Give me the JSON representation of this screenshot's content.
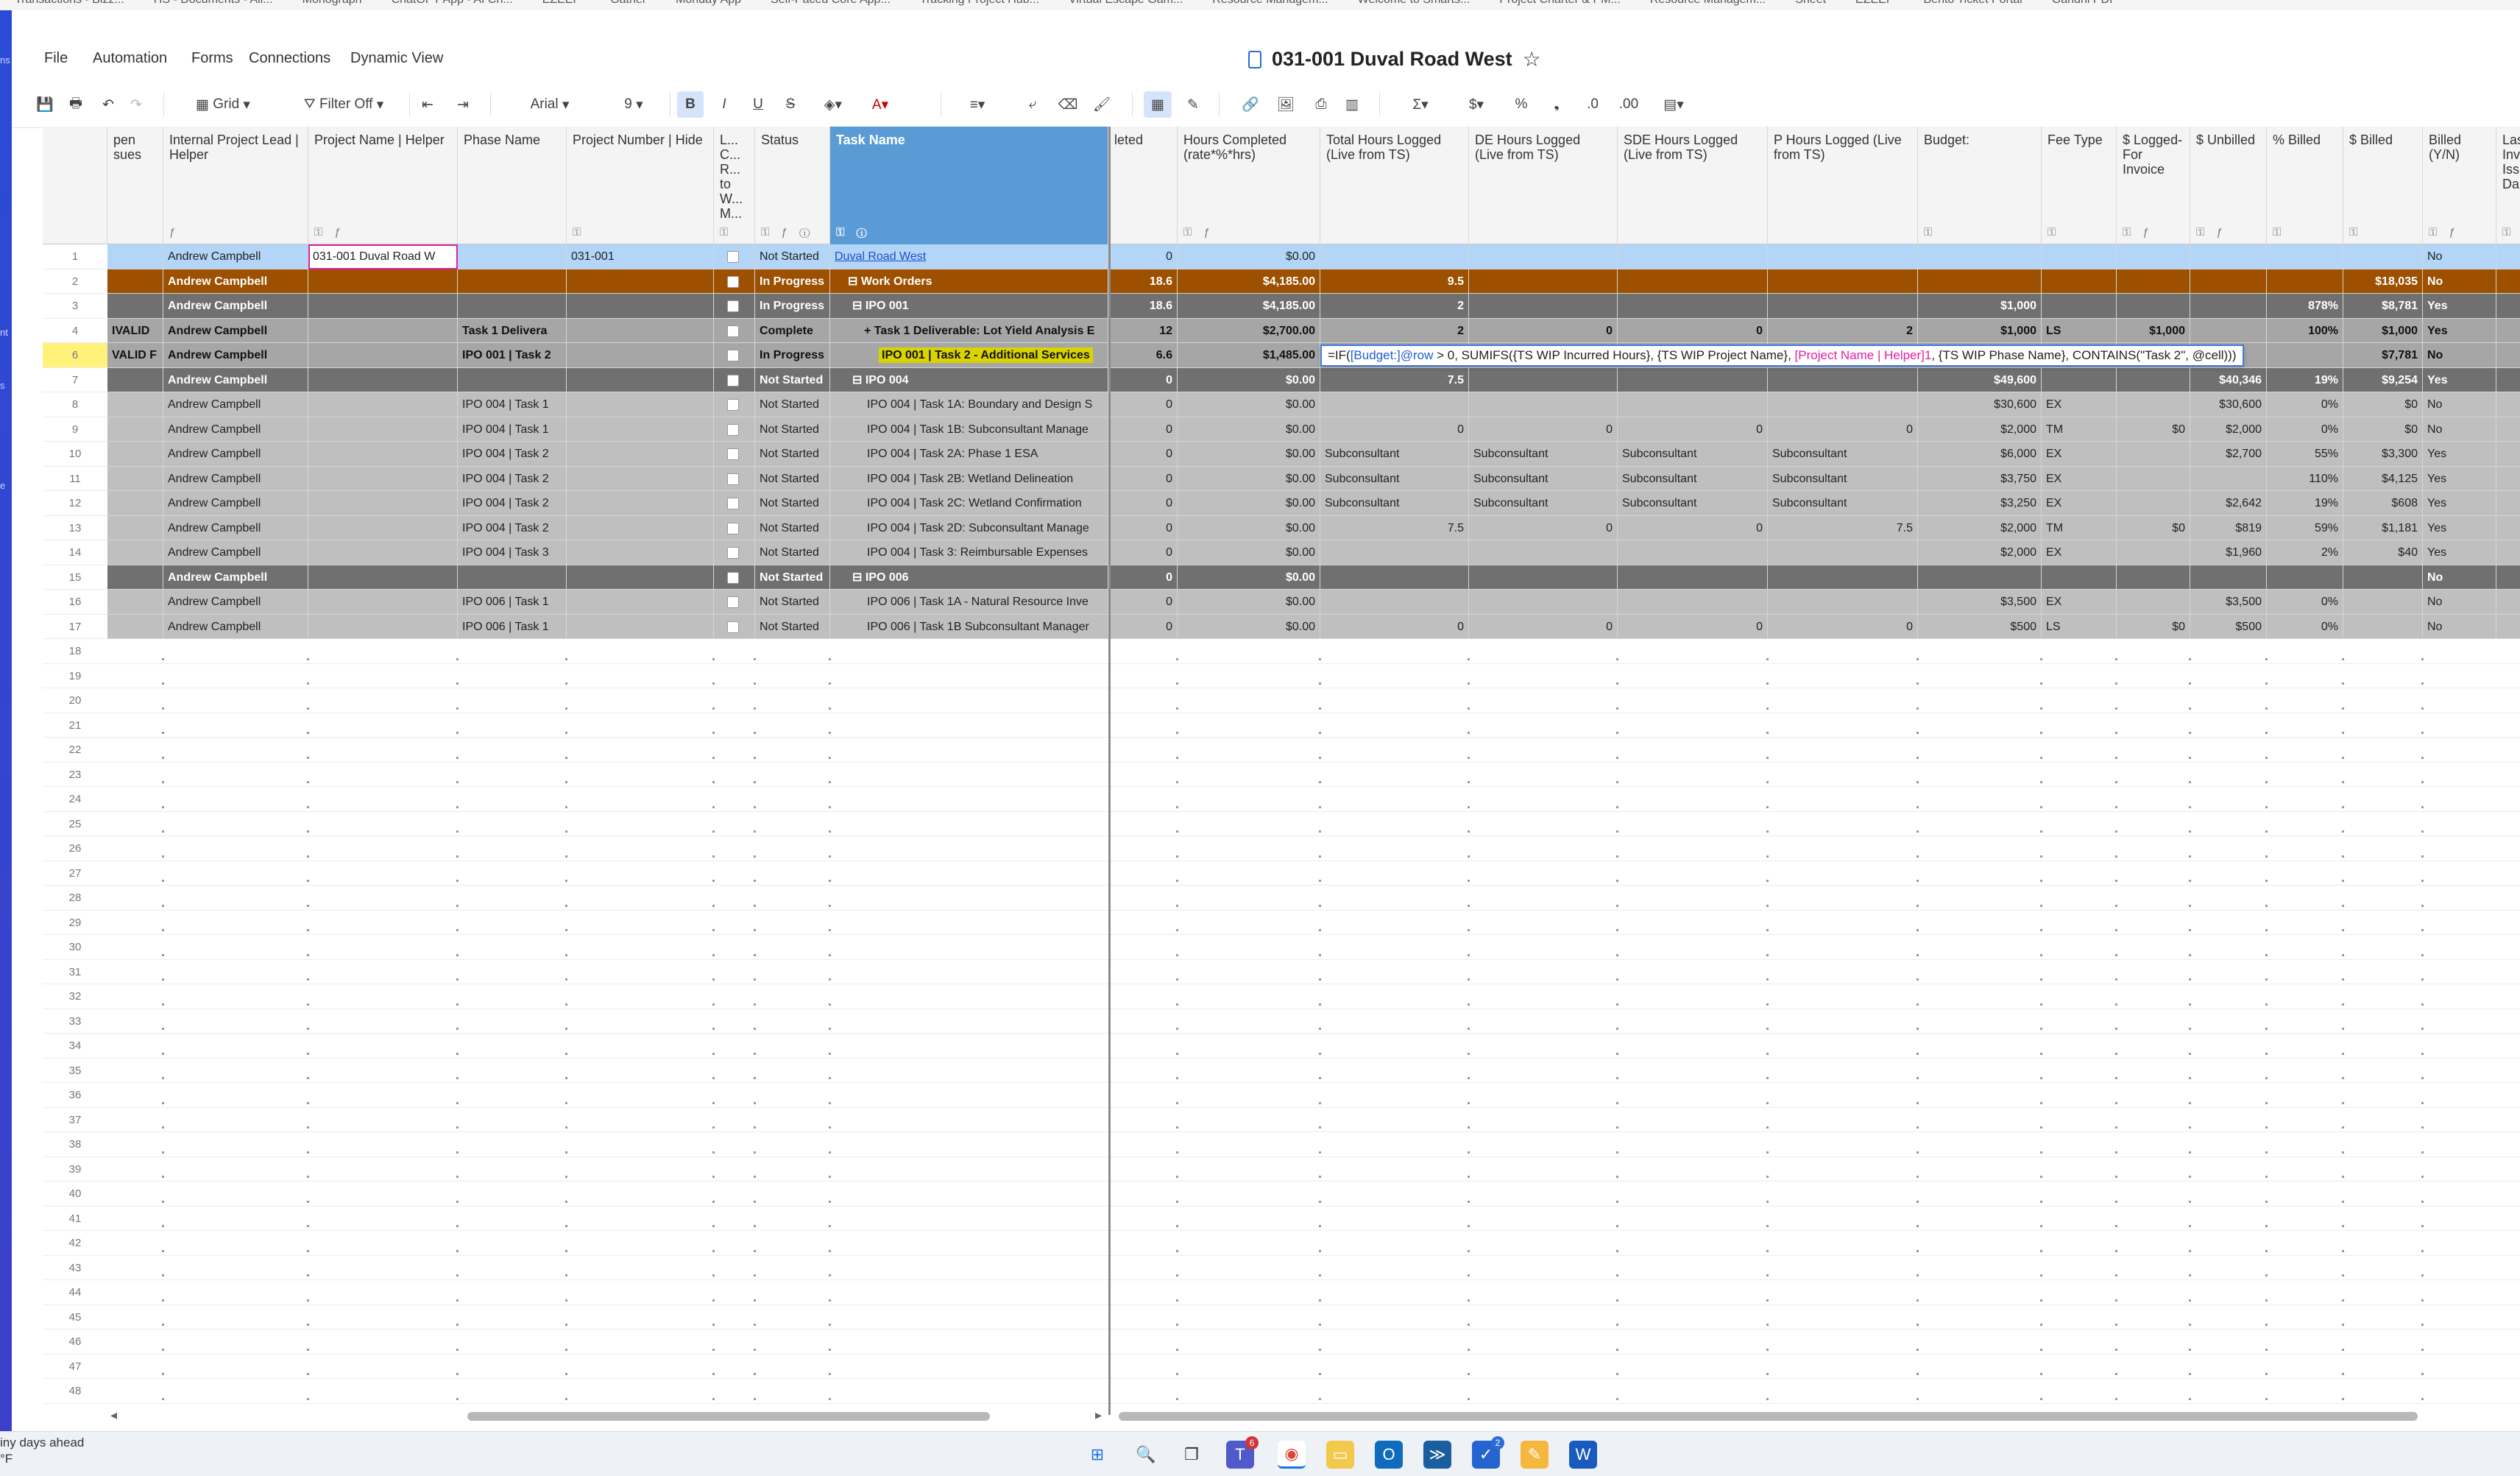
{
  "bookmarks": [
    "Transactions - Bizz...",
    "HS - Documents - All...",
    "Monograph",
    "ChatGPT App - AI Ch...",
    "EZEEP",
    "Gather",
    "Monday App",
    "Self-Paced Core App...",
    "Tracking Project Hub...",
    "Virtual Escape Gam...",
    "Resource Managem...",
    "Welcome to Smarts...",
    "Project Charter & PM...",
    "Resource Managem...",
    "Sheet",
    "EZEEP",
    "Bento Ticket Portal",
    "Gandhi PDF"
  ],
  "left_rail": [
    "ns",
    "nt",
    "s",
    "e"
  ],
  "menu": {
    "file": "File",
    "automation": "Automation",
    "forms": "Forms",
    "connections": "Connections",
    "dynamic_view": "Dynamic View"
  },
  "doc": {
    "title": "031-001 Duval Road West"
  },
  "toolbar": {
    "view": "Grid",
    "filter": "Filter Off",
    "font": "Arial",
    "size": "9"
  },
  "columns": [
    {
      "label": "pen\nsues"
    },
    {
      "label": "Internal Project Lead | Helper"
    },
    {
      "label": "Project Name | Helper"
    },
    {
      "label": "Phase Name"
    },
    {
      "label": "Project Number | Hide"
    },
    {
      "label": "L... C... R... to W... M..."
    },
    {
      "label": "Status"
    },
    {
      "label": "Task Name"
    },
    {
      "label": "leted"
    },
    {
      "label": "Hours Completed (rate*%*hrs)"
    },
    {
      "label": "Total Hours Logged (Live from TS)"
    },
    {
      "label": "DE Hours Logged (Live from TS)"
    },
    {
      "label": "SDE Hours Logged (Live from TS)"
    },
    {
      "label": "P Hours Logged (Live from TS)"
    },
    {
      "label": "Budget:"
    },
    {
      "label": "Fee Type"
    },
    {
      "label": "$ Logged- For Invoice"
    },
    {
      "label": "$ Unbilled"
    },
    {
      "label": "% Billed"
    },
    {
      "label": "$ Billed"
    },
    {
      "label": "Billed (Y/N)"
    },
    {
      "label": "Las Inv Iss Da"
    }
  ],
  "rows": [
    {
      "n": "1",
      "c": [
        "",
        "Andrew Campbell",
        "031-001 Duval Road W",
        "",
        "031-001",
        "",
        "Not Started",
        "Duval Road West",
        "0",
        "$0.00",
        "",
        "",
        "",
        "",
        "",
        "",
        "",
        "",
        "",
        "",
        "No",
        ""
      ]
    },
    {
      "n": "2",
      "c": [
        "",
        "Andrew Campbell",
        "",
        "",
        "",
        "",
        "In Progress",
        "Work Orders",
        "18.6",
        "$4,185.00",
        "9.5",
        "",
        "",
        "",
        "",
        "",
        "",
        "",
        "",
        "$18,035",
        "No",
        ""
      ]
    },
    {
      "n": "3",
      "c": [
        "",
        "Andrew Campbell",
        "",
        "",
        "",
        "",
        "In Progress",
        "IPO 001",
        "18.6",
        "$4,185.00",
        "2",
        "",
        "",
        "",
        "$1,000",
        "",
        "",
        "",
        "878%",
        "$8,781",
        "Yes",
        ""
      ]
    },
    {
      "n": "4",
      "c": [
        "IVALID",
        "Andrew Campbell",
        "",
        "Task 1 Delivera",
        "",
        "",
        "Complete",
        "Task 1 Deliverable: Lot Yield Analysis E",
        "12",
        "$2,700.00",
        "2",
        "0",
        "0",
        "2",
        "$1,000",
        "LS",
        "$1,000",
        "",
        "100%",
        "$1,000",
        "Yes",
        ""
      ]
    },
    {
      "n": "6",
      "c": [
        "VALID F",
        "Andrew Campbell",
        "",
        "IPO 001 | Task 2",
        "",
        "",
        "In Progress",
        "IPO 001 | Task 2 - Additional Services",
        "6.6",
        "$1,485.00",
        "",
        "",
        "",
        "",
        "",
        "",
        "",
        "",
        "",
        "$7,781",
        "No",
        ""
      ]
    },
    {
      "n": "7",
      "c": [
        "",
        "Andrew Campbell",
        "",
        "",
        "",
        "",
        "Not Started",
        "IPO 004",
        "0",
        "$0.00",
        "7.5",
        "",
        "",
        "",
        "$49,600",
        "",
        "",
        "$40,346",
        "19%",
        "$9,254",
        "Yes",
        ""
      ]
    },
    {
      "n": "8",
      "c": [
        "",
        "Andrew Campbell",
        "",
        "IPO 004 | Task 1",
        "",
        "",
        "Not Started",
        "IPO 004 | Task 1A: Boundary and Design S",
        "0",
        "$0.00",
        "",
        "",
        "",
        "",
        "$30,600",
        "EX",
        "",
        "$30,600",
        "0%",
        "$0",
        "No",
        ""
      ]
    },
    {
      "n": "9",
      "c": [
        "",
        "Andrew Campbell",
        "",
        "IPO 004 | Task 1",
        "",
        "",
        "Not Started",
        "IPO 004 | Task 1B: Subconsultant Manage",
        "0",
        "$0.00",
        "0",
        "0",
        "0",
        "0",
        "$2,000",
        "TM",
        "$0",
        "$2,000",
        "0%",
        "$0",
        "No",
        ""
      ]
    },
    {
      "n": "10",
      "c": [
        "",
        "Andrew Campbell",
        "",
        "IPO 004 | Task 2",
        "",
        "",
        "Not Started",
        "IPO 004 | Task 2A: Phase 1 ESA",
        "0",
        "$0.00",
        "Subconsultant",
        "Subconsultant",
        "Subconsultant",
        "Subconsultant",
        "$6,000",
        "EX",
        "",
        "$2,700",
        "55%",
        "$3,300",
        "Yes",
        ""
      ]
    },
    {
      "n": "11",
      "c": [
        "",
        "Andrew Campbell",
        "",
        "IPO 004 | Task 2",
        "",
        "",
        "Not Started",
        "IPO 004 | Task 2B: Wetland Delineation",
        "0",
        "$0.00",
        "Subconsultant",
        "Subconsultant",
        "Subconsultant",
        "Subconsultant",
        "$3,750",
        "EX",
        "",
        "",
        "110%",
        "$4,125",
        "Yes",
        ""
      ]
    },
    {
      "n": "12",
      "c": [
        "",
        "Andrew Campbell",
        "",
        "IPO 004 | Task 2",
        "",
        "",
        "Not Started",
        "IPO 004 | Task 2C: Wetland Confirmation",
        "0",
        "$0.00",
        "Subconsultant",
        "Subconsultant",
        "Subconsultant",
        "Subconsultant",
        "$3,250",
        "EX",
        "",
        "$2,642",
        "19%",
        "$608",
        "Yes",
        ""
      ]
    },
    {
      "n": "13",
      "c": [
        "",
        "Andrew Campbell",
        "",
        "IPO 004 | Task 2",
        "",
        "",
        "Not Started",
        "IPO 004 | Task 2D: Subconsultant Manage",
        "0",
        "$0.00",
        "7.5",
        "0",
        "0",
        "7.5",
        "$2,000",
        "TM",
        "$0",
        "$819",
        "59%",
        "$1,181",
        "Yes",
        ""
      ]
    },
    {
      "n": "14",
      "c": [
        "",
        "Andrew Campbell",
        "",
        "IPO 004 | Task 3",
        "",
        "",
        "Not Started",
        "IPO 004 | Task 3: Reimbursable Expenses",
        "0",
        "$0.00",
        "",
        "",
        "",
        "",
        "$2,000",
        "EX",
        "",
        "$1,960",
        "2%",
        "$40",
        "Yes",
        ""
      ]
    },
    {
      "n": "15",
      "c": [
        "",
        "Andrew Campbell",
        "",
        "",
        "",
        "",
        "Not Started",
        "IPO 006",
        "0",
        "$0.00",
        "",
        "",
        "",
        "",
        "",
        "",
        "",
        "",
        "",
        "",
        "No",
        ""
      ]
    },
    {
      "n": "16",
      "c": [
        "",
        "Andrew Campbell",
        "",
        "IPO 006 | Task 1",
        "",
        "",
        "Not Started",
        "IPO 006 | Task 1A - Natural Resource Inve",
        "0",
        "$0.00",
        "",
        "",
        "",
        "",
        "$3,500",
        "EX",
        "",
        "$3,500",
        "0%",
        "",
        "No",
        ""
      ]
    },
    {
      "n": "17",
      "c": [
        "",
        "Andrew Campbell",
        "",
        "IPO 006 | Task 1",
        "",
        "",
        "Not Started",
        "IPO 006 | Task 1B Subconsultant Manager",
        "0",
        "$0.00",
        "0",
        "0",
        "0",
        "0",
        "$500",
        "LS",
        "$0",
        "$500",
        "0%",
        "",
        "No",
        ""
      ]
    }
  ],
  "empty_rows": [
    "18",
    "19",
    "20",
    "21",
    "22",
    "23",
    "24",
    "25",
    "26",
    "27",
    "28",
    "29",
    "30",
    "31",
    "32",
    "33",
    "34",
    "35",
    "36",
    "37",
    "38",
    "39",
    "40",
    "41",
    "42",
    "43",
    "44",
    "45",
    "46",
    "47",
    "48"
  ],
  "formula": {
    "part1": "=IF(",
    "ref1": "[Budget:]@row",
    "part2": " > 0, SUMIFS({TS WIP Incurred Hours}, {TS WIP Project Name}, ",
    "ref2": "[Project Name | Helper]1",
    "part3": ", {TS WIP Phase Name}, CONTAINS(\"Task 2\", @cell)))"
  },
  "weather": {
    "line1": "iny days ahead",
    "line2": "°F"
  },
  "taskbar": {
    "teams_badge": "6",
    "todo_badge": "2"
  },
  "colors": {
    "accent": "#5b9bd5",
    "orange_row": "#9c5000",
    "dark_row": "#707070",
    "mid_row": "#a6a6a6",
    "light_row": "#bfbfbf",
    "selected_row": "#b3d5f7",
    "highlight": "#fff17a",
    "formula_pink": "#e01fa4"
  }
}
